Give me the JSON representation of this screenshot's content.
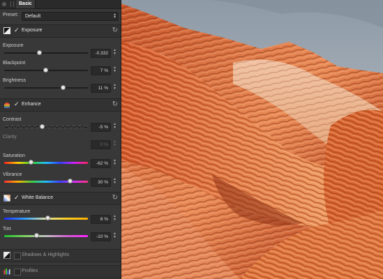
{
  "titlebar": {
    "tab_label": "Basic"
  },
  "preset": {
    "label": "Preset:",
    "value": "Default"
  },
  "sections": {
    "exposure": {
      "label": "Exposure",
      "enabled": true
    },
    "enhance": {
      "label": "Enhance",
      "enabled": true
    },
    "white_balance": {
      "label": "White Balance",
      "enabled": true
    },
    "shadows_highlights": {
      "label": "Shadows & Highlights",
      "enabled": false
    },
    "profiles": {
      "label": "Profiles",
      "enabled": false
    }
  },
  "controls": {
    "exposure": {
      "label": "Exposure",
      "value": "-0.332",
      "level": 0.42
    },
    "blackpoint": {
      "label": "Blackpoint",
      "value": "7 %",
      "level": 0.49
    },
    "brightness": {
      "label": "Brightness",
      "value": "11 %",
      "level": 0.7
    },
    "contrast": {
      "label": "Contrast",
      "value": "-5 %",
      "level": 0.45
    },
    "clarity": {
      "label": "Clarity",
      "value": "0 %",
      "level": 0.5
    },
    "saturation": {
      "label": "Saturation",
      "value": "-62 %",
      "level": 0.32
    },
    "vibrance": {
      "label": "Vibrance",
      "value": "30 %",
      "level": 0.78
    },
    "temperature": {
      "label": "Temperature",
      "value": "6 %",
      "level": 0.52
    },
    "tint": {
      "label": "Tint",
      "value": "-10 %",
      "level": 0.38
    }
  },
  "icons": {
    "reset": "reset-icon",
    "stepper": "stepper-icon",
    "check": "check-icon"
  },
  "colors": {
    "panel_bg": "#383838",
    "section_bg": "#323232",
    "knob": "#e8e8e8"
  }
}
